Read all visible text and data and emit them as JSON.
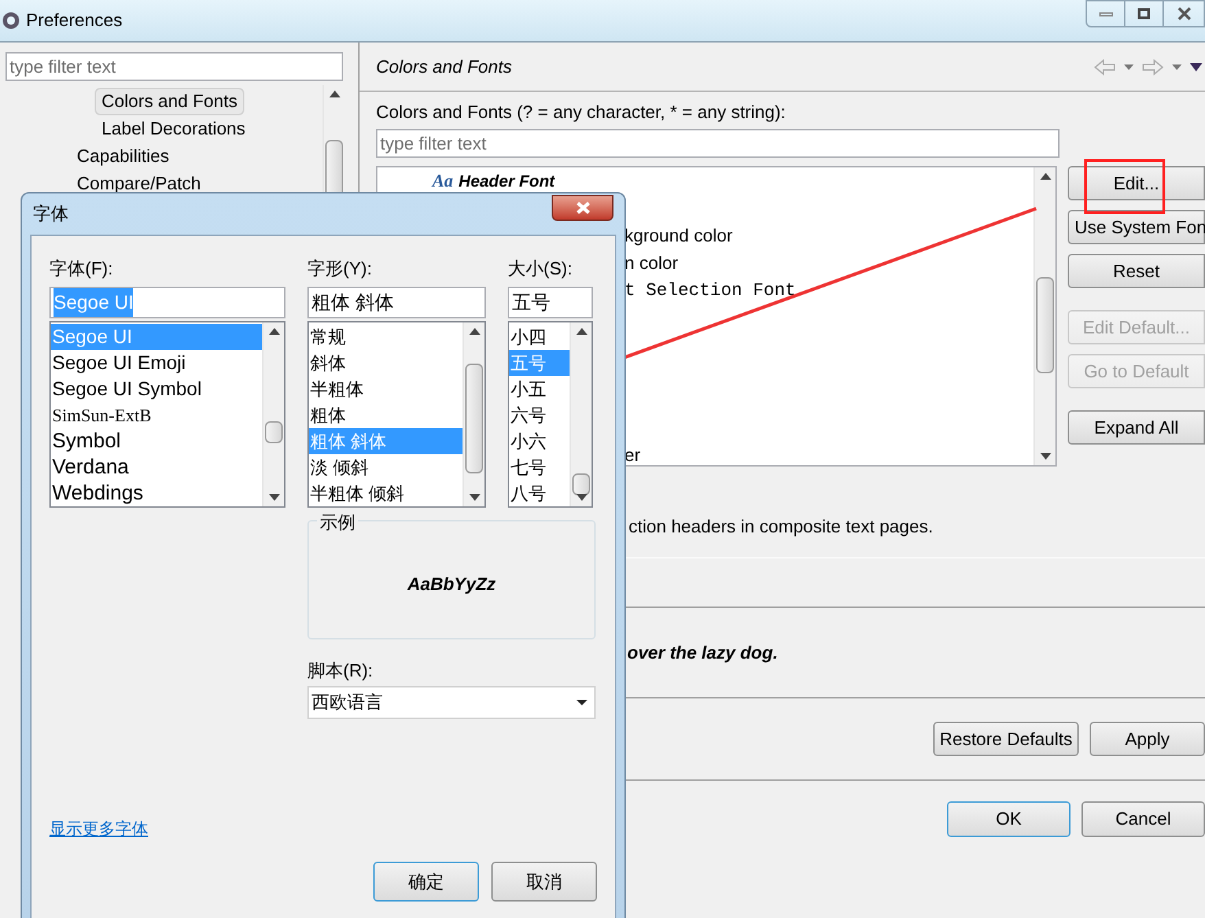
{
  "window": {
    "title": "Preferences"
  },
  "sidebar": {
    "filter_placeholder": "type filter text",
    "items": [
      {
        "children": [
          {
            "label": "Colors and Fonts",
            "selected": true
          },
          {
            "label": "Label Decorations",
            "selected": false
          }
        ]
      },
      {
        "label": "Capabilities",
        "selected": false
      },
      {
        "label": "Compare/Patch",
        "selected": false
      }
    ]
  },
  "page": {
    "title": "Colors and Fonts",
    "filter_label": "Colors and Fonts (? = any character, * = any string):",
    "filter_placeholder": "type filter text",
    "tree_items": [
      {
        "label": "Header Font",
        "kind": "font",
        "icon_text": "Aa"
      },
      {
        "label": "kground color",
        "kind": "plain"
      },
      {
        "label": "n color",
        "kind": "plain"
      },
      {
        "label": "t Selection Font",
        "kind": "mono"
      },
      {
        "label": "er",
        "kind": "plain"
      }
    ],
    "buttons": [
      {
        "label": "Edit...",
        "disabled": false
      },
      {
        "label": "Use System Fon",
        "disabled": false
      },
      {
        "label": "Reset",
        "disabled": false
      },
      {
        "label": "Edit Default...",
        "disabled": true
      },
      {
        "label": "Go to Default",
        "disabled": true
      },
      {
        "label": "Expand All",
        "disabled": false
      }
    ],
    "description": "ction headers in composite text pages.",
    "preview": "over the lazy dog.",
    "footer_buttons": [
      "Restore Defaults",
      "Apply"
    ],
    "dialog_buttons": [
      {
        "label": "OK",
        "default": true
      },
      {
        "label": "Cancel",
        "default": false
      }
    ]
  },
  "font_dialog": {
    "title": "字体",
    "font": {
      "label": "字体(F):",
      "value": "Segoe UI",
      "options": [
        {
          "label": "Segoe UI",
          "selected": true,
          "kind": "sans"
        },
        {
          "label": "Segoe UI Emoji",
          "selected": false,
          "kind": "sans"
        },
        {
          "label": "Segoe UI Symbol",
          "selected": false,
          "kind": "sans"
        },
        {
          "label": "SimSun-ExtB",
          "selected": false,
          "kind": "serif"
        },
        {
          "label": "Symbol",
          "selected": false,
          "kind": "large"
        },
        {
          "label": "Verdana",
          "selected": false,
          "kind": "large"
        },
        {
          "label": "Webdings",
          "selected": false,
          "kind": "large"
        }
      ]
    },
    "style": {
      "label": "字形(Y):",
      "value": "粗体 斜体",
      "options": [
        {
          "label": "常规",
          "selected": false
        },
        {
          "label": "斜体",
          "selected": false
        },
        {
          "label": "半粗体",
          "selected": false
        },
        {
          "label": "粗体",
          "selected": false
        },
        {
          "label": "粗体 斜体",
          "selected": true
        },
        {
          "label": "淡 倾斜",
          "selected": false
        },
        {
          "label": "半粗体 倾斜",
          "selected": false
        }
      ]
    },
    "size": {
      "label": "大小(S):",
      "value": "五号",
      "options": [
        {
          "label": "小四",
          "selected": false
        },
        {
          "label": "五号",
          "selected": true
        },
        {
          "label": "小五",
          "selected": false
        },
        {
          "label": "六号",
          "selected": false
        },
        {
          "label": "小六",
          "selected": false
        },
        {
          "label": "七号",
          "selected": false
        },
        {
          "label": "八号",
          "selected": false
        }
      ]
    },
    "sample": {
      "label": "示例",
      "text": "AaBbYyZz"
    },
    "script": {
      "label": "脚本(R):",
      "value": "西欧语言"
    },
    "more_link": "显示更多字体",
    "buttons": [
      {
        "label": "确定",
        "default": true
      },
      {
        "label": "取消",
        "default": false
      }
    ]
  }
}
